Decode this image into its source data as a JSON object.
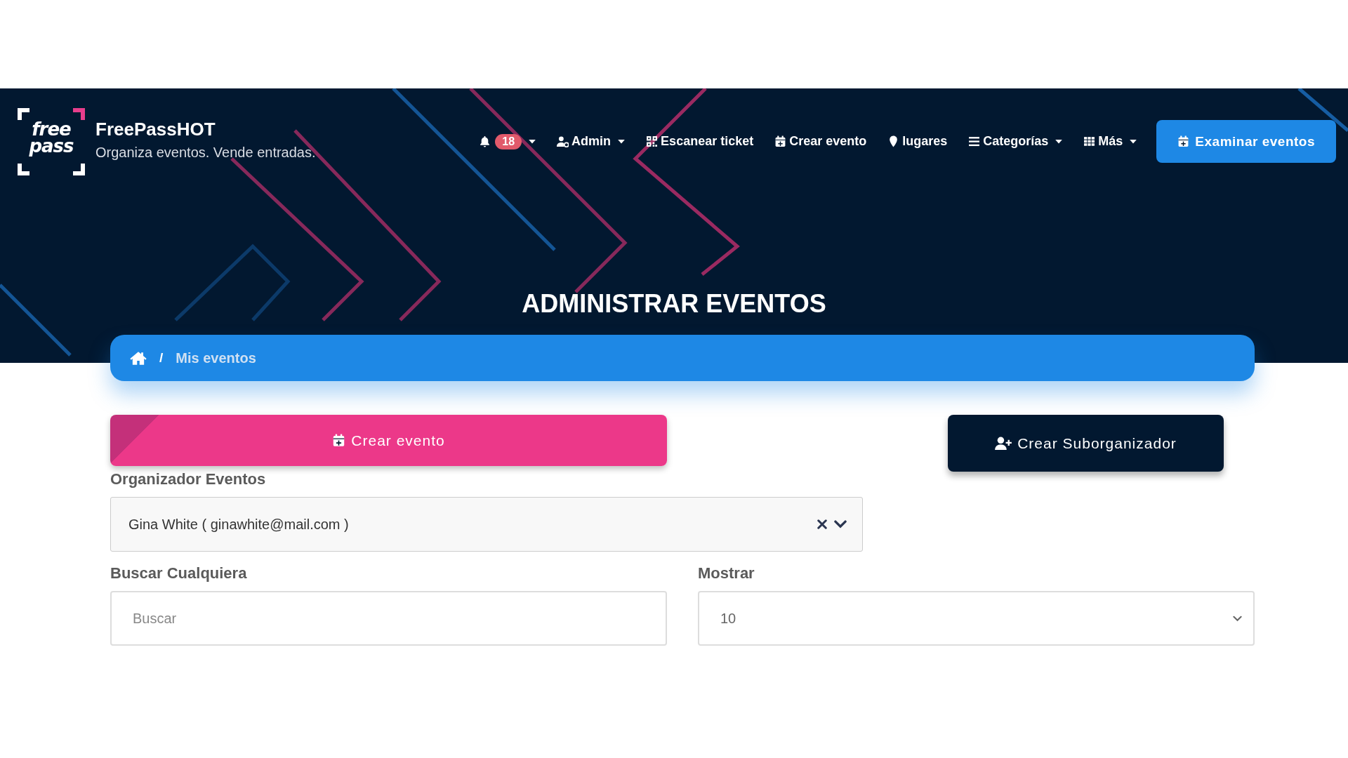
{
  "header": {
    "logo_text": [
      "free",
      "pass"
    ],
    "site_name": "FreePassHOT",
    "tagline": "Organiza eventos. Vende entradas.",
    "nav": [
      {
        "kind": "bell",
        "badge": "18",
        "dropdown": true
      },
      {
        "kind": "user",
        "label": "Admin",
        "dropdown": true
      },
      {
        "kind": "qr",
        "label": "Escanear ticket",
        "dropdown": false
      },
      {
        "kind": "calendar",
        "label": "Crear evento",
        "dropdown": false
      },
      {
        "kind": "pin",
        "label": "lugares",
        "dropdown": false
      },
      {
        "kind": "list",
        "label": "Categorías",
        "dropdown": true
      },
      {
        "kind": "grid",
        "label": "Más",
        "dropdown": true
      }
    ],
    "cta": "Examinar eventos"
  },
  "page_title": "ADMINISTRAR EVENTOS",
  "breadcrumb": [
    {
      "separator": "/",
      "label": "Mis eventos"
    }
  ],
  "actions": {
    "create_event": "Crear evento",
    "create_suborganizer": "Crear Suborganizador"
  },
  "organizer": {
    "label": "Organizador Eventos",
    "value": "Gina White ( ginawhite@mail.com )"
  },
  "search": {
    "label": "Buscar Cualquiera",
    "placeholder": "Buscar"
  },
  "show": {
    "label": "Mostrar",
    "value": "10"
  }
}
